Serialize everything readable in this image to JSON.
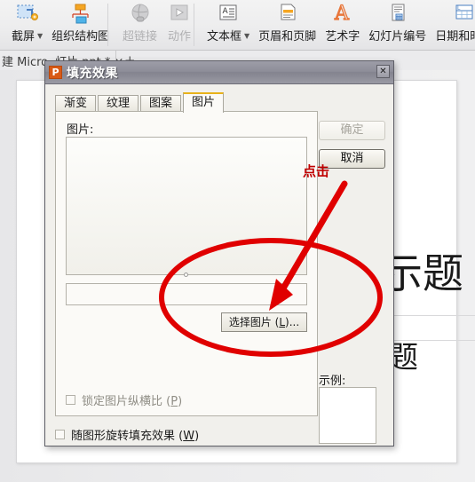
{
  "ribbon": {
    "groups": [
      {
        "name": "illustrations",
        "items": [
          {
            "label": "截屏",
            "icon": "screenshot-icon",
            "dropdown": true,
            "disabled": false
          },
          {
            "label": "组织结构图",
            "icon": "org-chart-icon",
            "dropdown": false,
            "disabled": false
          }
        ]
      },
      {
        "name": "links",
        "items": [
          {
            "label": "超链接",
            "icon": "hyperlink-icon",
            "dropdown": false,
            "disabled": true
          },
          {
            "label": "动作",
            "icon": "action-icon",
            "dropdown": false,
            "disabled": true
          }
        ]
      },
      {
        "name": "text",
        "items": [
          {
            "label": "文本框",
            "icon": "textbox-icon",
            "dropdown": true,
            "disabled": false
          },
          {
            "label": "页眉和页脚",
            "icon": "header-footer-icon",
            "dropdown": false,
            "disabled": false
          },
          {
            "label": "艺术字",
            "icon": "wordart-icon",
            "dropdown": false,
            "disabled": false
          },
          {
            "label": "幻灯片编号",
            "icon": "slide-number-icon",
            "dropdown": false,
            "disabled": false
          },
          {
            "label": "日期和时间",
            "icon": "date-time-icon",
            "dropdown": false,
            "disabled": false
          }
        ]
      }
    ]
  },
  "tabstrip": {
    "left_text": "建 Micro",
    "doc_tab": "灯片.ppt * ×",
    "new_tab": "+"
  },
  "slide": {
    "title_fragment": "示题",
    "subtitle_fragment": "题"
  },
  "dialog": {
    "title": "填充效果",
    "app_icon_glyph": "P",
    "close_glyph": "✕",
    "tabs": [
      {
        "label": "渐变",
        "active": false
      },
      {
        "label": "纹理",
        "active": false
      },
      {
        "label": "图案",
        "active": false
      },
      {
        "label": "图片",
        "active": true
      }
    ],
    "picture_section_label": "图片:",
    "picture_path_value": "",
    "select_picture_button": {
      "prefix": "选择图片 (",
      "accel": "L",
      "suffix": ")..."
    },
    "lock_aspect_checkbox": {
      "prefix": "锁定图片纵横比 (",
      "accel": "P",
      "suffix": ")",
      "checked": false,
      "disabled": true
    },
    "rotate_with_shape_checkbox": {
      "prefix": "随图形旋转填充效果 (",
      "accel": "W",
      "suffix": ")",
      "checked": false,
      "disabled": false
    },
    "ok_button": {
      "label": "确定",
      "disabled": true
    },
    "cancel_button": {
      "label": "取消",
      "disabled": false
    },
    "sample_label": "示例:"
  },
  "annotation": {
    "click_text": "点击",
    "color": "#c00000"
  },
  "colors": {
    "annotation_red": "#c00000",
    "titlebar_gray": "#8e8e99",
    "app_orange": "#d85a16",
    "active_tab_accent": "#e8b21a"
  }
}
